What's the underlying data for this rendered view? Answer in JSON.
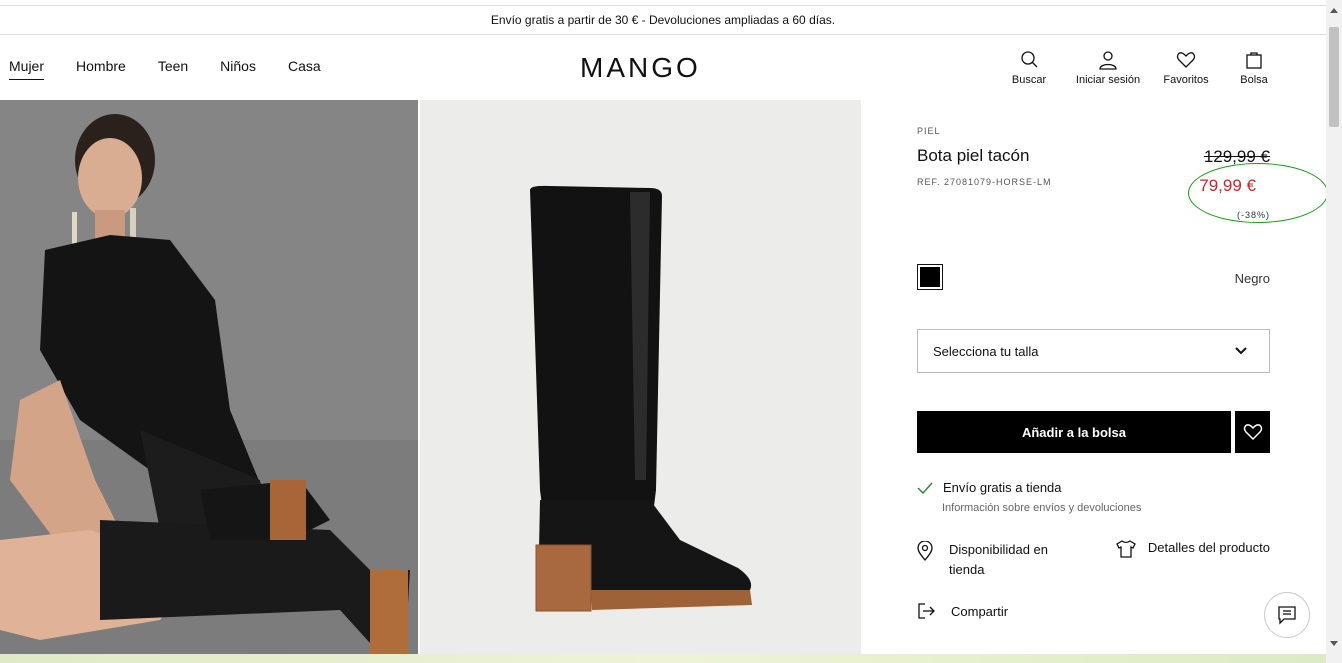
{
  "promo": {
    "text": "Envío gratis a partir de 30 € - Devoluciones ampliadas a 60 días."
  },
  "nav": {
    "items": [
      "Mujer",
      "Hombre",
      "Teen",
      "Niños",
      "Casa"
    ],
    "active": "Mujer"
  },
  "logo": "MANGO",
  "tools": {
    "search": "Buscar",
    "login": "Iniciar sesión",
    "favorites": "Favoritos",
    "bag": "Bolsa"
  },
  "product": {
    "category": "PIEL",
    "title": "Bota piel tacón",
    "ref": "REF. 27081079-HORSE-LM",
    "old_price": "129,99 €",
    "new_price": "79,99 €",
    "discount": "(-38%)",
    "color_name": "Negro",
    "size_placeholder": "Selecciona tu talla",
    "add_button": "Añadir a la bolsa",
    "shipping": "Envío gratis a tienda",
    "shipping_info": "Información sobre envíos y devoluciones",
    "availability": "Disponibilidad en tienda",
    "details": "Detalles del producto",
    "share": "Compartir"
  },
  "colors": {
    "sale": "#c2282c",
    "highlight": "#1a9a1a",
    "swatch": "#000000"
  },
  "icons": [
    "search-icon",
    "user-icon",
    "heart-icon",
    "bag-icon",
    "chevron-down-icon",
    "check-icon",
    "location-pin-icon",
    "shirt-icon",
    "share-icon",
    "chat-icon"
  ]
}
